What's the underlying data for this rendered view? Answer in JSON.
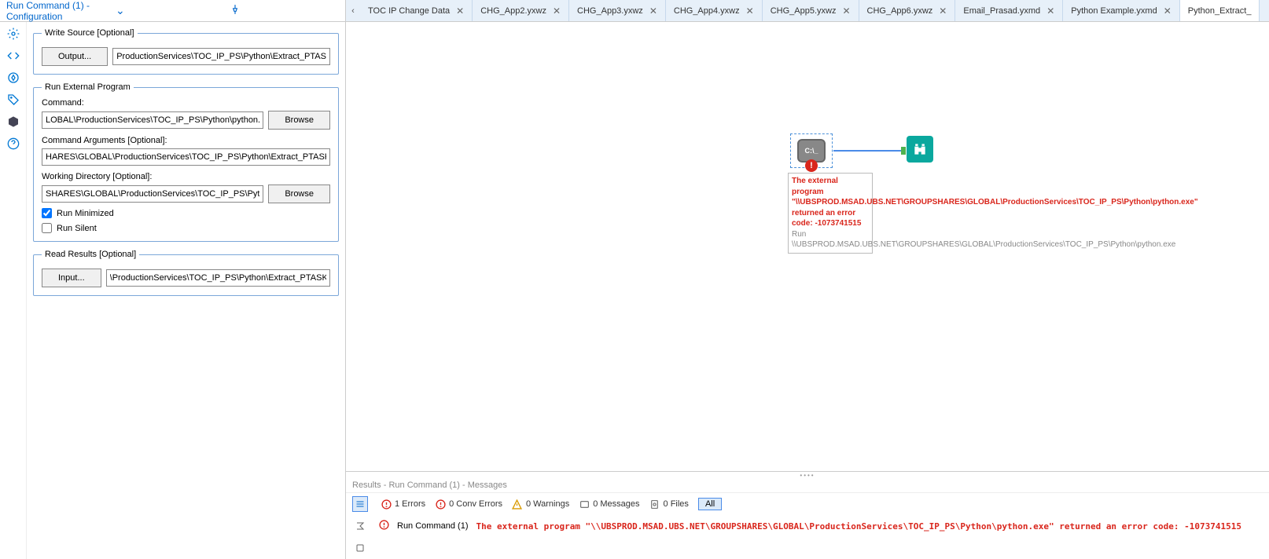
{
  "panel": {
    "title": "Run Command (1) - Configuration"
  },
  "config": {
    "write_source_legend": "Write Source [Optional]",
    "output_btn": "Output...",
    "output_path": "ProductionServices\\TOC_IP_PS\\Python\\Extract_PTASK.csv",
    "run_ext_legend": "Run External Program",
    "command_label": "Command:",
    "command_value": "LOBAL\\ProductionServices\\TOC_IP_PS\\Python\\python.exe",
    "browse_btn": "Browse",
    "args_label": "Command Arguments [Optional]:",
    "args_value": "HARES\\GLOBAL\\ProductionServices\\TOC_IP_PS\\Python\\Extract_PTASK.py\"",
    "workdir_label": "Working Directory [Optional]:",
    "workdir_value": "SHARES\\GLOBAL\\ProductionServices\\TOC_IP_PS\\Python",
    "run_minimized": "Run Minimized",
    "run_silent": "Run Silent",
    "read_results_legend": "Read Results [Optional]",
    "input_btn": "Input...",
    "input_path": "\\ProductionServices\\TOC_IP_PS\\Python\\Extract_PTASK.txt"
  },
  "tabs": [
    {
      "label": "TOC IP Change Data",
      "closable": true
    },
    {
      "label": "CHG_App2.yxwz",
      "closable": true
    },
    {
      "label": "CHG_App3.yxwz",
      "closable": true
    },
    {
      "label": "CHG_App4.yxwz",
      "closable": true
    },
    {
      "label": "CHG_App5.yxwz",
      "closable": true
    },
    {
      "label": "CHG_App6.yxwz",
      "closable": true
    },
    {
      "label": "Email_Prasad.yxmd",
      "closable": true
    },
    {
      "label": "Python Example.yxmd",
      "closable": true
    },
    {
      "label": "Python_Extract_",
      "closable": false,
      "active": true
    }
  ],
  "canvas": {
    "run_cmd_label": "C:\\_",
    "error_text": "The external program \"\\\\UBSPROD.MSAD.UBS.NET\\GROUPSHARES\\GLOBAL\\ProductionServices\\TOC_IP_PS\\Python\\python.exe\" returned an error code: -1073741515",
    "grey_text": "Run \\\\UBSPROD.MSAD.UBS.NET\\GROUPSHARES\\GLOBAL\\ProductionServices\\TOC_IP_PS\\Python\\python.exe"
  },
  "results": {
    "header": "Results - Run Command (1) - Messages",
    "errors": "1 Errors",
    "conv": "0 Conv Errors",
    "warnings": "0 Warnings",
    "messages": "0 Messages",
    "files": "0 Files",
    "all": "All",
    "source": "Run Command (1)",
    "message": "The external program \"\\\\UBSPROD.MSAD.UBS.NET\\GROUPSHARES\\GLOBAL\\ProductionServices\\TOC_IP_PS\\Python\\python.exe\" returned an error code: -1073741515"
  }
}
